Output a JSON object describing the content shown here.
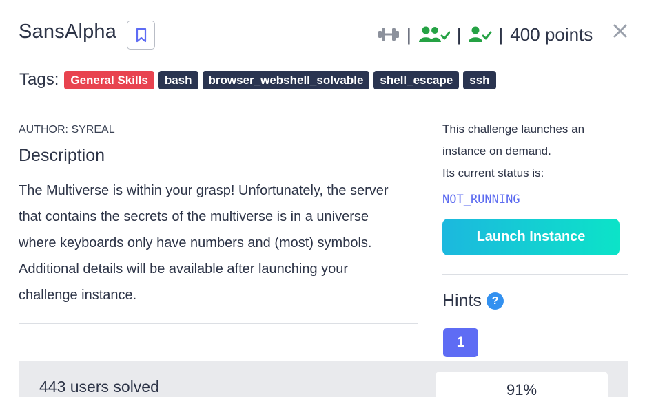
{
  "challenge": {
    "title": "SansAlpha",
    "points": "400 points"
  },
  "icons": {
    "bookmark": "bookmark-icon",
    "difficulty": "dumbbell-icon",
    "users_solved": "users-check-icon",
    "user_solved": "user-check-icon",
    "close": "close-icon",
    "help": "question-circle-icon"
  },
  "tags": {
    "label": "Tags:",
    "items": [
      {
        "label": "General Skills",
        "color": "#e8434f"
      },
      {
        "label": "bash",
        "color": "#2a3450"
      },
      {
        "label": "browser_webshell_solvable",
        "color": "#2a3450"
      },
      {
        "label": "shell_escape",
        "color": "#2a3450"
      },
      {
        "label": "ssh",
        "color": "#2a3450"
      }
    ]
  },
  "content": {
    "author": "AUTHOR: SYREAL",
    "description_heading": "Description",
    "description_lines": [
      "The Multiverse is within your grasp! Unfortunately, the server",
      "that contains the secrets of the multiverse is in a universe",
      "where keyboards only have numbers and (most) symbols.",
      "Additional details will be available after launching your",
      "challenge instance."
    ]
  },
  "instance": {
    "line1": "This challenge launches an",
    "line2": "instance on demand.",
    "line3": "Its current status is:",
    "status": "NOT_RUNNING",
    "launch_label": "Launch Instance"
  },
  "hints": {
    "heading": "Hints",
    "help_symbol": "?",
    "items": [
      "1"
    ]
  },
  "footer": {
    "solved": "443 users solved",
    "percent": "91%"
  },
  "colors": {
    "accent_green": "#25a244",
    "accent_blue": "#5e6cf4",
    "launch_gradient_start": "#1cb8de",
    "launch_gradient_end": "#0ce3c8",
    "status_color": "#5c6bf0"
  }
}
